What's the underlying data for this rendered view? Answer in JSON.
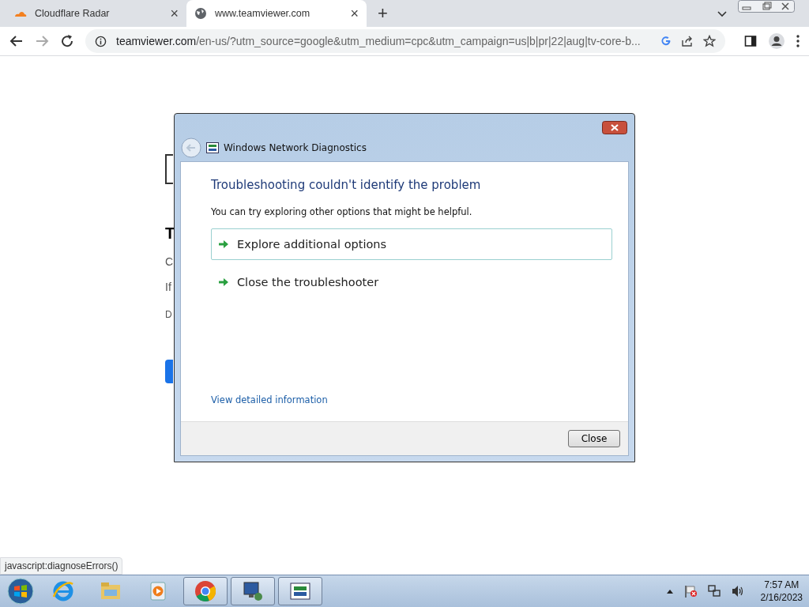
{
  "browser": {
    "tabs": [
      {
        "title": "Cloudflare Radar",
        "selected": false,
        "close": "×"
      },
      {
        "title": "www.teamviewer.com",
        "selected": true,
        "close": "×"
      }
    ],
    "new_tab": "+",
    "url_host": "teamviewer.com",
    "url_rest": "/en-us/?utm_source=google&utm_medium=cpc&utm_campaign=us|b|pr|22|aug|tv-core-b...",
    "status_text": "javascript:diagnoseErrors()"
  },
  "page_fragments": [
    "T",
    "C",
    "If",
    "D"
  ],
  "dialog": {
    "title": "Windows Network Diagnostics",
    "heading": "Troubleshooting couldn't identify the problem",
    "message": "You can try exploring other options that might be helpful.",
    "options": [
      {
        "label": "Explore additional options",
        "selected": true
      },
      {
        "label": "Close the troubleshooter",
        "selected": false
      }
    ],
    "details_link": "View detailed information",
    "close_button": "Close"
  },
  "taskbar": {
    "apps": [
      {
        "kind": "ie",
        "active": false
      },
      {
        "kind": "folder",
        "active": false
      },
      {
        "kind": "media",
        "active": false
      },
      {
        "kind": "chrome",
        "active": true
      },
      {
        "kind": "monitor",
        "active": true
      },
      {
        "kind": "network",
        "active": true
      }
    ],
    "time": "7:57 AM",
    "date": "2/16/2023"
  }
}
